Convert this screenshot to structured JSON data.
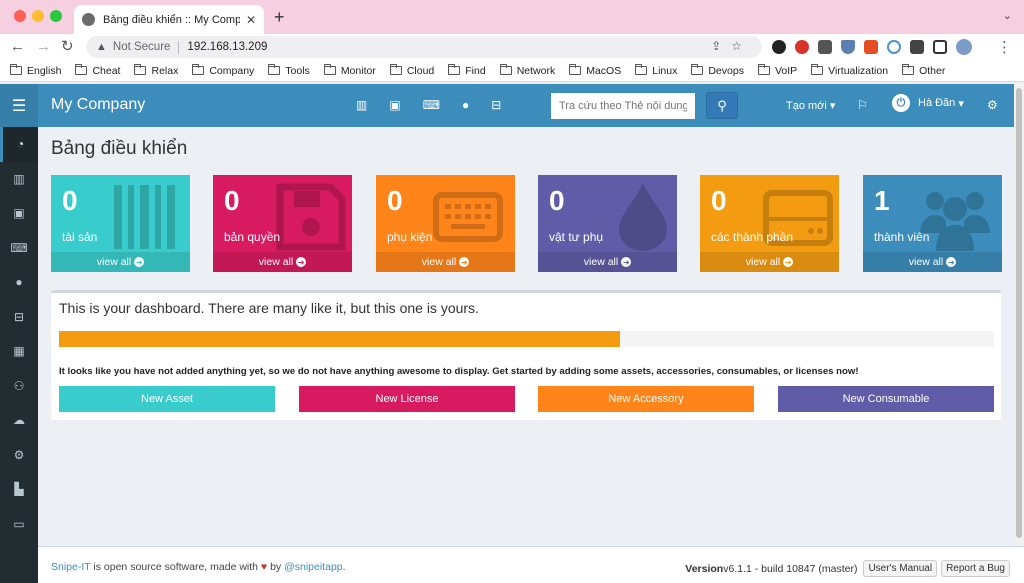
{
  "browser": {
    "tab_title": "Bảng điều khiển :: My Company",
    "address_prefix": "Not Secure",
    "url": "192.168.13.209",
    "bookmarks": [
      "English",
      "Cheat",
      "Relax",
      "Company",
      "Tools",
      "Monitor",
      "Cloud",
      "Find",
      "Network",
      "MacOS",
      "Linux",
      "Devops",
      "VoIP",
      "Virtualization",
      "Other"
    ]
  },
  "header": {
    "brand": "My Company",
    "search_placeholder": "Tra cứu theo Thẻ nội dung",
    "create_new": "Tạo mới",
    "user_name": "Hà Đăn"
  },
  "page": {
    "title": "Bảng điều khiển"
  },
  "tiles": [
    {
      "count": "0",
      "label": "tài sản",
      "link": "view all",
      "color": "#39cccc",
      "icon": "barcode-icon"
    },
    {
      "count": "0",
      "label": "bản quyền",
      "link": "view all",
      "color": "#d81b60",
      "icon": "floppy-icon"
    },
    {
      "count": "0",
      "label": "phụ kiện",
      "link": "view all",
      "color": "#ff851b",
      "icon": "keyboard-icon"
    },
    {
      "count": "0",
      "label": "vật tư phụ",
      "link": "view all",
      "color": "#605ca8",
      "icon": "drop-icon"
    },
    {
      "count": "0",
      "label": "các thành phần",
      "link": "view all",
      "color": "#f39c12",
      "icon": "hdd-icon"
    },
    {
      "count": "1",
      "label": "thành viên",
      "link": "view all",
      "color": "#3c8dbc",
      "icon": "users-icon"
    }
  ],
  "dashboard": {
    "heading": "This is your dashboard. There are many like it, but this one is yours.",
    "progress_percent": 60,
    "notice": "It looks like you have not added anything yet, so we do not have anything awesome to display. Get started by adding some assets, accessories, consumables, or licenses now!",
    "buttons": [
      {
        "label": "New Asset",
        "color": "#39cccc"
      },
      {
        "label": "New License",
        "color": "#d81b60"
      },
      {
        "label": "New Accessory",
        "color": "#ff851b"
      },
      {
        "label": "New Consumable",
        "color": "#605ca8"
      }
    ]
  },
  "footer": {
    "app_name": "Snipe-IT",
    "text_middle": " is open source software, made with ",
    "text_by": " by ",
    "handle": "@snipeitapp",
    "period": ".",
    "version_label": "Version",
    "version_value": " v6.1.1 - build 10847 (master)",
    "manual": "User's Manual",
    "bug": "Report a Bug"
  }
}
